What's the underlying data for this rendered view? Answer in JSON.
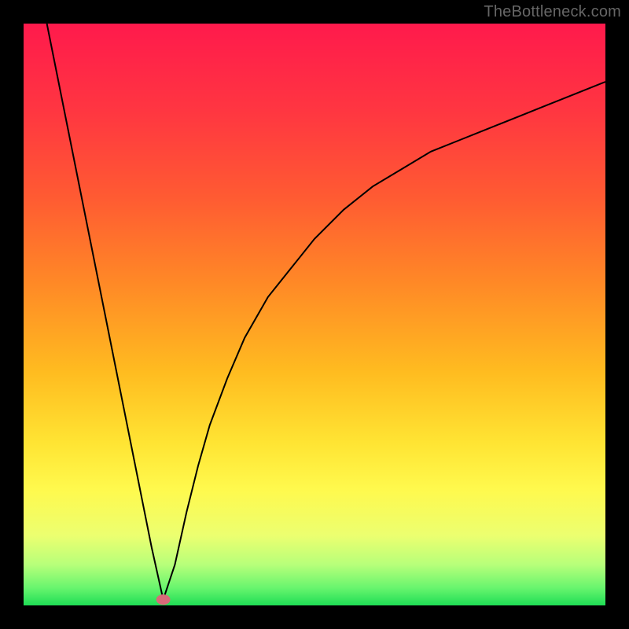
{
  "watermark": "TheBottleneck.com",
  "chart_data": {
    "type": "line",
    "title": "",
    "xlabel": "",
    "ylabel": "",
    "xlim": [
      0,
      100
    ],
    "ylim": [
      0,
      100
    ],
    "notes": "Gradient background from red (top) through orange/yellow to green (bottom). Single black curve: percentage bottleneck vs. a swept variable. V-shaped: falls steeply from top-left to a minimum near x≈24, y≈0, then rises with diminishing slope toward the right, approaching ~90 at x=100. Small pink marker at minimum. No axis ticks or labels visible.",
    "series": [
      {
        "name": "curve",
        "color": "#000000",
        "x": [
          4,
          6,
          8,
          10,
          12,
          14,
          16,
          18,
          20,
          22,
          24,
          26,
          28,
          30,
          32,
          35,
          38,
          42,
          46,
          50,
          55,
          60,
          65,
          70,
          75,
          80,
          85,
          90,
          95,
          100
        ],
        "y": [
          100,
          90,
          80,
          70,
          60,
          50,
          40,
          30,
          20,
          10,
          1,
          7,
          16,
          24,
          31,
          39,
          46,
          53,
          58,
          63,
          68,
          72,
          75,
          78,
          80,
          82,
          84,
          86,
          88,
          90
        ]
      }
    ],
    "marker": {
      "x": 24,
      "y": 1,
      "color": "#d96a79"
    },
    "gradient_stops": [
      {
        "offset": 0.0,
        "color": "#ff1a4c"
      },
      {
        "offset": 0.15,
        "color": "#ff3641"
      },
      {
        "offset": 0.3,
        "color": "#ff5b32"
      },
      {
        "offset": 0.45,
        "color": "#ff8a26"
      },
      {
        "offset": 0.6,
        "color": "#ffbc20"
      },
      {
        "offset": 0.72,
        "color": "#ffe433"
      },
      {
        "offset": 0.8,
        "color": "#fff94d"
      },
      {
        "offset": 0.88,
        "color": "#ecff70"
      },
      {
        "offset": 0.93,
        "color": "#b7ff7a"
      },
      {
        "offset": 0.97,
        "color": "#68f56e"
      },
      {
        "offset": 1.0,
        "color": "#1fdd55"
      }
    ]
  }
}
